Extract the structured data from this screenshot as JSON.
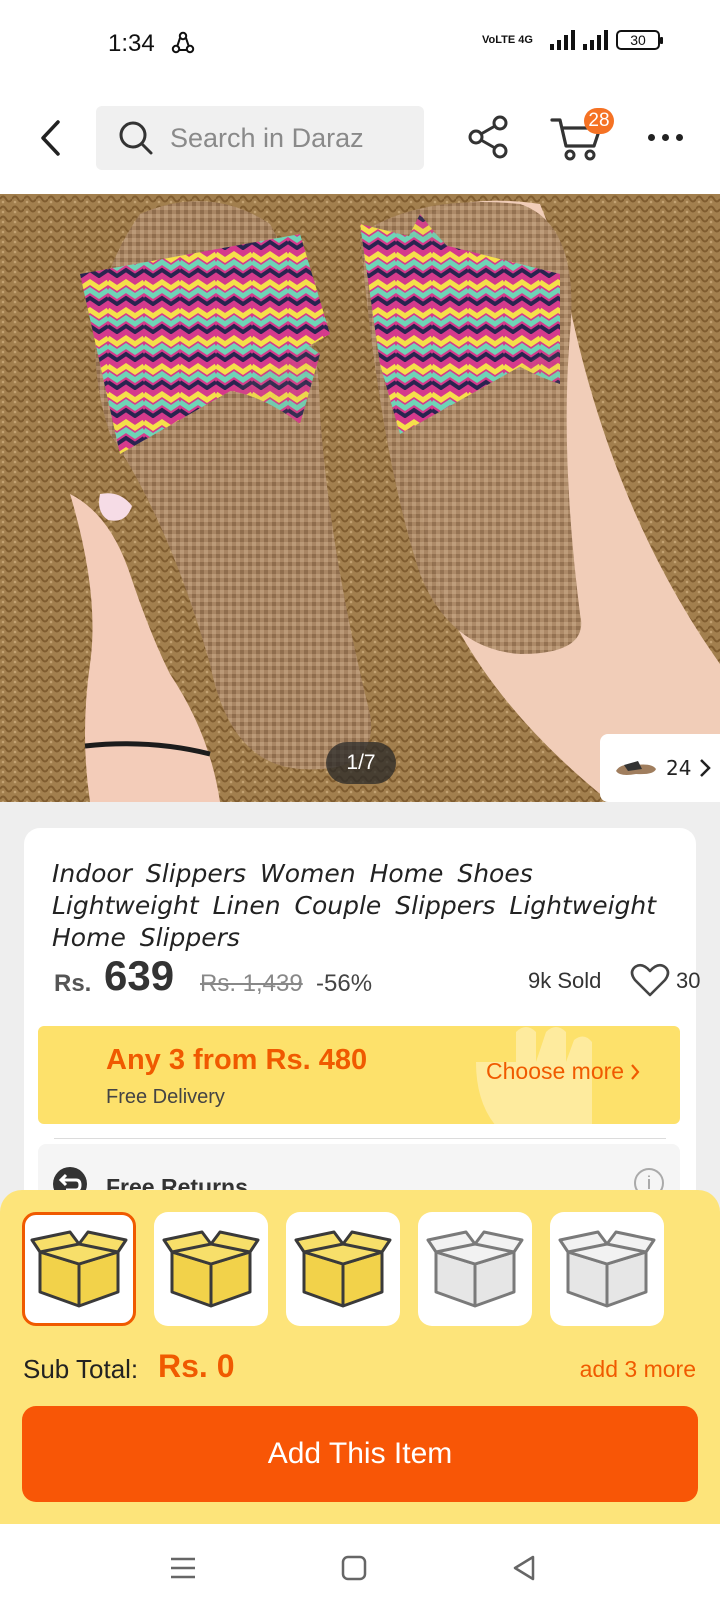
{
  "status_bar": {
    "time": "1:34",
    "network": "VoLTE 4G",
    "battery": "30"
  },
  "header": {
    "search_placeholder": "Search in Daraz",
    "cart_count": "28"
  },
  "gallery": {
    "counter": "1/7",
    "variant_count": "24"
  },
  "product": {
    "title": "Indoor Slippers Women Home Shoes Lightweight Linen Couple Slippers Lightweight Home Slippers",
    "currency": "Rs.",
    "price": "639",
    "original_price": "Rs. 1,439",
    "discount": "-56%",
    "sold": "9k Sold",
    "wishlist_count": "30"
  },
  "promo": {
    "title": "Any 3 from Rs. 480",
    "subtitle": "Free Delivery",
    "link": "Choose more"
  },
  "returns": {
    "label": "Free Returns."
  },
  "bundle": {
    "slots": [
      {
        "state": "selected-empty",
        "color": "#f2d24a"
      },
      {
        "state": "empty",
        "color": "#f2d24a"
      },
      {
        "state": "empty",
        "color": "#f2d24a"
      },
      {
        "state": "locked",
        "color": "#e6e6e6"
      },
      {
        "state": "locked",
        "color": "#e6e6e6"
      }
    ],
    "subtotal_label": "Sub Total:",
    "subtotal_value": "Rs. 0",
    "add_more": "add 3 more",
    "button": "Add This Item"
  },
  "colors": {
    "accent": "#f85606",
    "promo_bg": "#fde16b",
    "panel_bg": "#fde47a"
  }
}
